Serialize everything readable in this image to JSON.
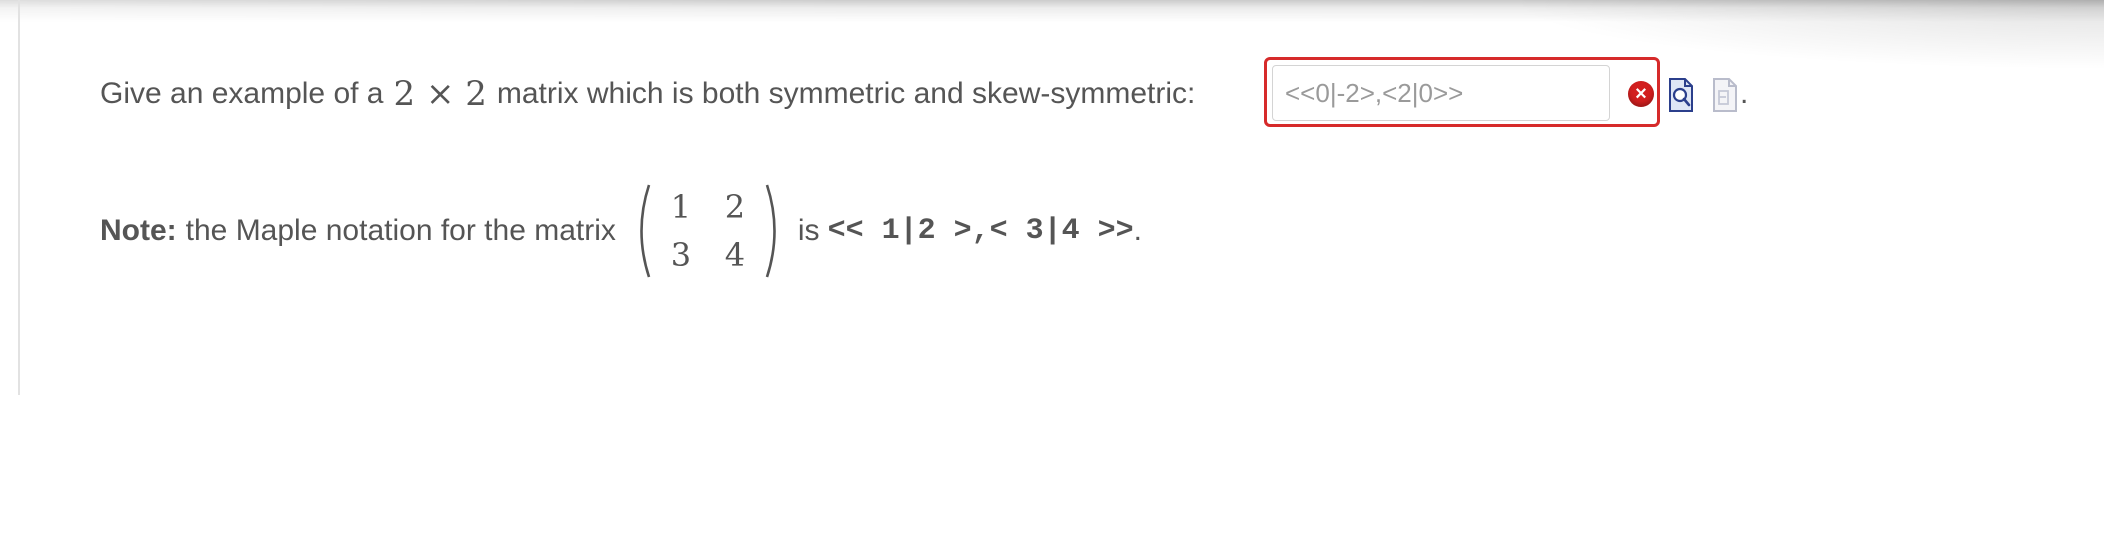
{
  "question": {
    "prefix": "Give an example of a",
    "math_dims": "2 × 2",
    "suffix": "matrix which is both symmetric and skew-symmetric:",
    "period": "."
  },
  "answer": {
    "value": "<<0|-2>,<2|0>>",
    "status": "incorrect",
    "border_color": "#d62a2a"
  },
  "icons": {
    "error": "error-x-icon",
    "preview": "preview-magnifier-icon",
    "feedback": "feedback-document-icon"
  },
  "note": {
    "label": "Note:",
    "text": "the Maple notation for the matrix",
    "matrix": [
      "1",
      "2",
      "3",
      "4"
    ],
    "is": "is",
    "code": "<< 1|2 >,< 3|4 >>",
    "period": "."
  }
}
